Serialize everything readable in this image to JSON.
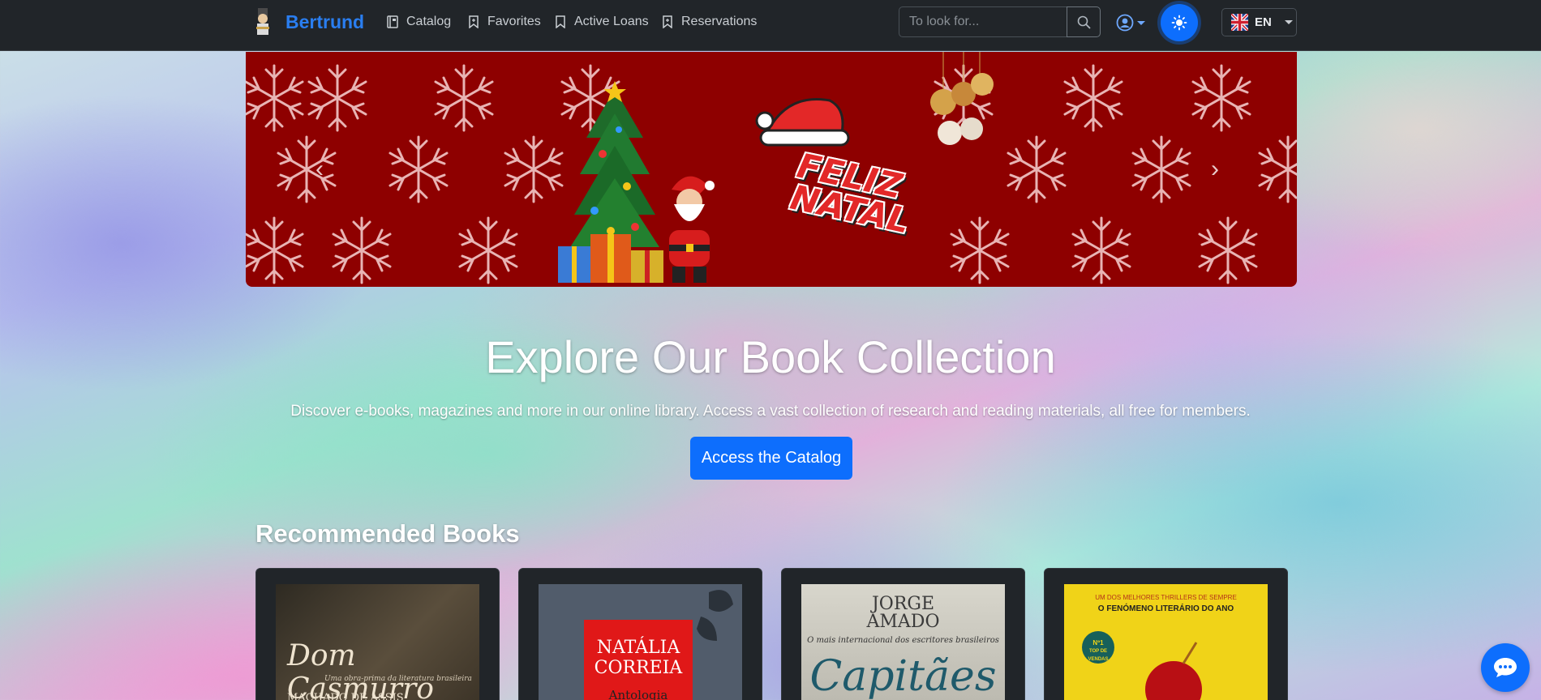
{
  "navbar": {
    "brand": "Bertrund",
    "links": [
      {
        "label": "Catalog",
        "icon": "book-icon"
      },
      {
        "label": "Favorites",
        "icon": "bookmark-icon"
      },
      {
        "label": "Active Loans",
        "icon": "bookmark-icon"
      },
      {
        "label": "Reservations",
        "icon": "bookmark-icon"
      }
    ],
    "search_placeholder": "To look for...",
    "language": "EN"
  },
  "banner": {
    "text_line1": "FELIZ",
    "text_line2": "NATAL"
  },
  "hero": {
    "title": "Explore Our Book Collection",
    "subtitle": "Discover e-books, magazines and more in our online library. Access a vast collection of research and reading materials, all free for members.",
    "cta": "Access the Catalog"
  },
  "recommended": {
    "title": "Recommended Books",
    "books": [
      {
        "line1": "Dom Casmurro",
        "line2": "Uma obra-prima da literatura brasileira",
        "line3": "MACHADO DE ASSIS"
      },
      {
        "line1": "NATÁLIA",
        "line2": "CORREIA",
        "line3": "Antologia"
      },
      {
        "line1": "JORGE",
        "line2": "AMADO",
        "line3": "O mais internacional dos escritores brasileiros",
        "line4": "Capitães"
      },
      {
        "line1": "UM DOS MELHORES THRILLERS DE SEMPRE",
        "line2": "O FENÓMENO LITERÁRIO DO ANO",
        "badge_top": "Nº1",
        "badge_bottom": "TOP DE VENDAS"
      }
    ]
  },
  "colors": {
    "navbar_bg": "#212529",
    "brand": "#2a7ef0",
    "primary": "#0d6efd",
    "banner_bg": "#8e0000"
  }
}
